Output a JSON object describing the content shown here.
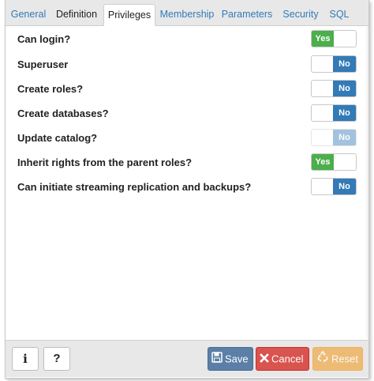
{
  "tabs": [
    {
      "label": "General"
    },
    {
      "label": "Definition"
    },
    {
      "label": "Privileges"
    },
    {
      "label": "Membership"
    },
    {
      "label": "Parameters"
    },
    {
      "label": "Security"
    },
    {
      "label": "SQL"
    }
  ],
  "active_tab": "Privileges",
  "privileges": [
    {
      "label": "Can login?",
      "value": "Yes",
      "enabled": true
    },
    {
      "label": "Superuser",
      "value": "No",
      "enabled": true
    },
    {
      "label": "Create roles?",
      "value": "No",
      "enabled": true
    },
    {
      "label": "Create databases?",
      "value": "No",
      "enabled": true
    },
    {
      "label": "Update catalog?",
      "value": "No",
      "enabled": false
    },
    {
      "label": "Inherit rights from the parent roles?",
      "value": "Yes",
      "enabled": true
    },
    {
      "label": "Can initiate streaming replication and backups?",
      "value": "No",
      "enabled": true
    }
  ],
  "footer": {
    "info_label": "i",
    "help_label": "?",
    "save_label": "Save",
    "cancel_label": "Cancel",
    "reset_label": "Reset"
  },
  "colors": {
    "yes_green": "#4cae4c",
    "no_blue": "#337ab7",
    "save": "#5b7fa6",
    "cancel": "#d9534f",
    "reset": "#f0ad4e",
    "tab_link": "#337ab7"
  },
  "icons": {
    "save": "floppy-disk-icon",
    "cancel": "x-icon",
    "reset": "recycle-icon"
  }
}
